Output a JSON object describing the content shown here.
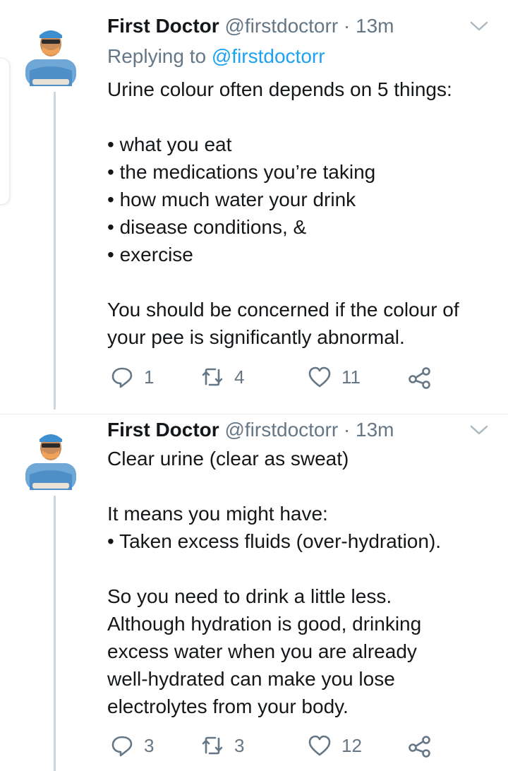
{
  "tweets": [
    {
      "name": "First Doctor",
      "handle": "@firstdoctorr",
      "separator": "·",
      "time": "13m",
      "replying_prefix": "Replying to",
      "replying_to": "@firstdoctorr",
      "lines": [
        "Urine colour often depends on 5 things:",
        "",
        "what you eat",
        "the medications you’re taking",
        "how much water your drink",
        "disease conditions, &",
        "exercise",
        "",
        "You should be concerned if the colour of",
        "your pee is significantly abnormal."
      ],
      "actions": {
        "replies": "1",
        "retweets": "4",
        "likes": "11"
      }
    },
    {
      "name": "First Doctor",
      "handle": "@firstdoctorr",
      "separator": "·",
      "time": "13m",
      "lines": [
        "Clear urine (clear as sweat)",
        "",
        "It means you might have:",
        "Taken excess fluids (over-hydration).",
        "",
        "So you need to drink a little less.",
        "Although hydration is good, drinking",
        "excess water when you are already",
        "well-hydrated can make you lose",
        "electrolytes from your body."
      ],
      "actions": {
        "replies": "3",
        "retweets": "3",
        "likes": "12"
      }
    }
  ],
  "icons": {
    "reply": "reply-icon",
    "retweet": "retweet-icon",
    "like": "heart-icon",
    "share": "share-icon",
    "menu": "chevron-down-icon"
  },
  "colors": {
    "text": "#14171a",
    "secondary": "#657786",
    "link": "#1da1f2",
    "thread_line": "#ccd6dd",
    "divider": "#e6ecf0"
  }
}
